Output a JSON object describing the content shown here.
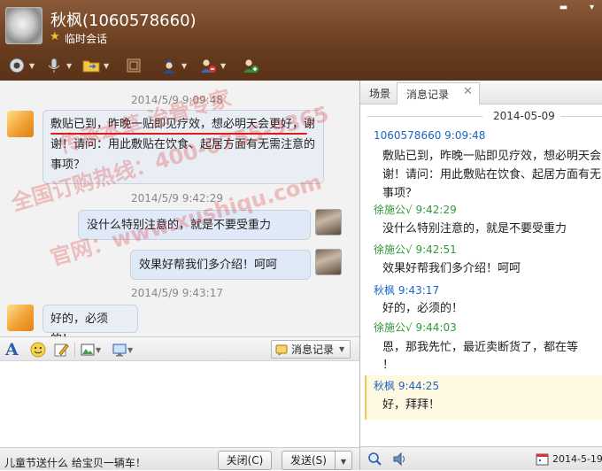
{
  "header": {
    "contact_name": "秋枫(1060578660)",
    "session_type": "临时会话"
  },
  "colors": {
    "header_brown": "#6a3e20",
    "link_blue": "#1a66c4",
    "sender_green": "#2f9a3a",
    "watermark_red": "#e12828"
  },
  "toolbar": {
    "icons": [
      "video-call-icon",
      "voice-call-icon",
      "file-transfer-icon",
      "remote-desktop-icon",
      "add-contact-icon",
      "remove-contact-icon",
      "invite-group-icon"
    ]
  },
  "chat": {
    "messages": [
      {
        "timestamp": "2014/5/9 9:09:48",
        "text": "敷贴已到，昨晚一贴即见疗效，想必明天会更好，谢谢！请问：用此敷贴在饮食、起居方面有无需注意的事项？",
        "direction": "in"
      },
      {
        "timestamp": "2014/5/9 9:42:29",
        "text": "没什么特别注意的，就是不要受重力",
        "direction": "out"
      },
      {
        "timestamp": "",
        "text": "效果好帮我们多介绍！呵呵",
        "direction": "out"
      },
      {
        "timestamp": "2014/5/9 9:43:17",
        "text": "好的，必须的！",
        "direction": "in"
      }
    ]
  },
  "watermark": {
    "line1": "全国订购热线：400-0755-9365",
    "line2": "传承本草 治骨专家",
    "line3": "官网：www.xushiqu.com"
  },
  "input_toolbar": {
    "message_record_label": "消息记录"
  },
  "bottom": {
    "ad_text": "儿童节送什么 给宝贝一辆车！",
    "close_label": "关闭(C)",
    "send_label": "发送(S)"
  },
  "history": {
    "tab_scene": "场景",
    "tab_messages": "消息记录",
    "date": "2014-05-09",
    "entries": [
      {
        "sender": "1060578660 9:09:48",
        "color": "blue",
        "lines": [
          "敷贴已到，昨晚一贴即见疗效，想必明天会",
          "谢！请问：用此敷贴在饮食、起居方面有无",
          "事项？"
        ]
      },
      {
        "sender": "徐施公√ 9:42:29",
        "color": "green",
        "lines": [
          "没什么特别注意的，就是不要受重力"
        ]
      },
      {
        "sender": "徐施公√ 9:42:51",
        "color": "green",
        "lines": [
          "效果好帮我们多介绍！呵呵"
        ]
      },
      {
        "sender": "秋枫 9:43:17",
        "color": "blue",
        "lines": [
          "好的，必须的！"
        ]
      },
      {
        "sender": "徐施公√ 9:44:03",
        "color": "green",
        "lines": [
          "恩，那我先忙，最近卖断货了，都在等",
          "！"
        ]
      },
      {
        "sender": "秋枫 9:44:25",
        "color": "blue",
        "lines": [
          "好，拜拜！"
        ]
      }
    ],
    "status_date": "2014-5-19"
  }
}
